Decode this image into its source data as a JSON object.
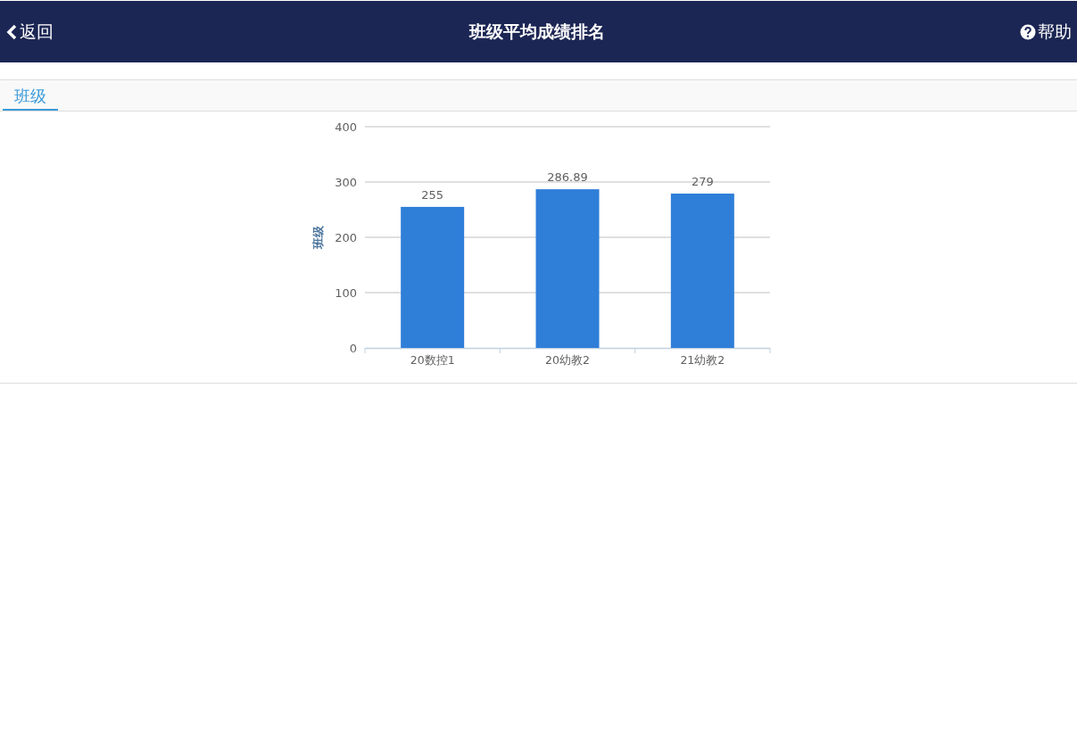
{
  "header": {
    "back": "返回",
    "title": "班级平均成绩排名",
    "help": "帮助"
  },
  "tabs": [
    {
      "label": "班级",
      "selected": true
    }
  ],
  "chart": {
    "chart_data": {
      "type": "bar",
      "ylabel": "班级",
      "categories": [
        "20数控1",
        "20幼教2",
        "21幼教2"
      ],
      "series": [
        {
          "color": "#2f7ed8",
          "values": [
            255,
            286.89,
            279
          ]
        }
      ],
      "grid": true,
      "ylim": [
        0,
        400
      ],
      "yticks": [
        0,
        100,
        200,
        300,
        400
      ],
      "data_labels": true,
      "value_labels": [
        "255",
        "286.89",
        "279"
      ]
    }
  }
}
